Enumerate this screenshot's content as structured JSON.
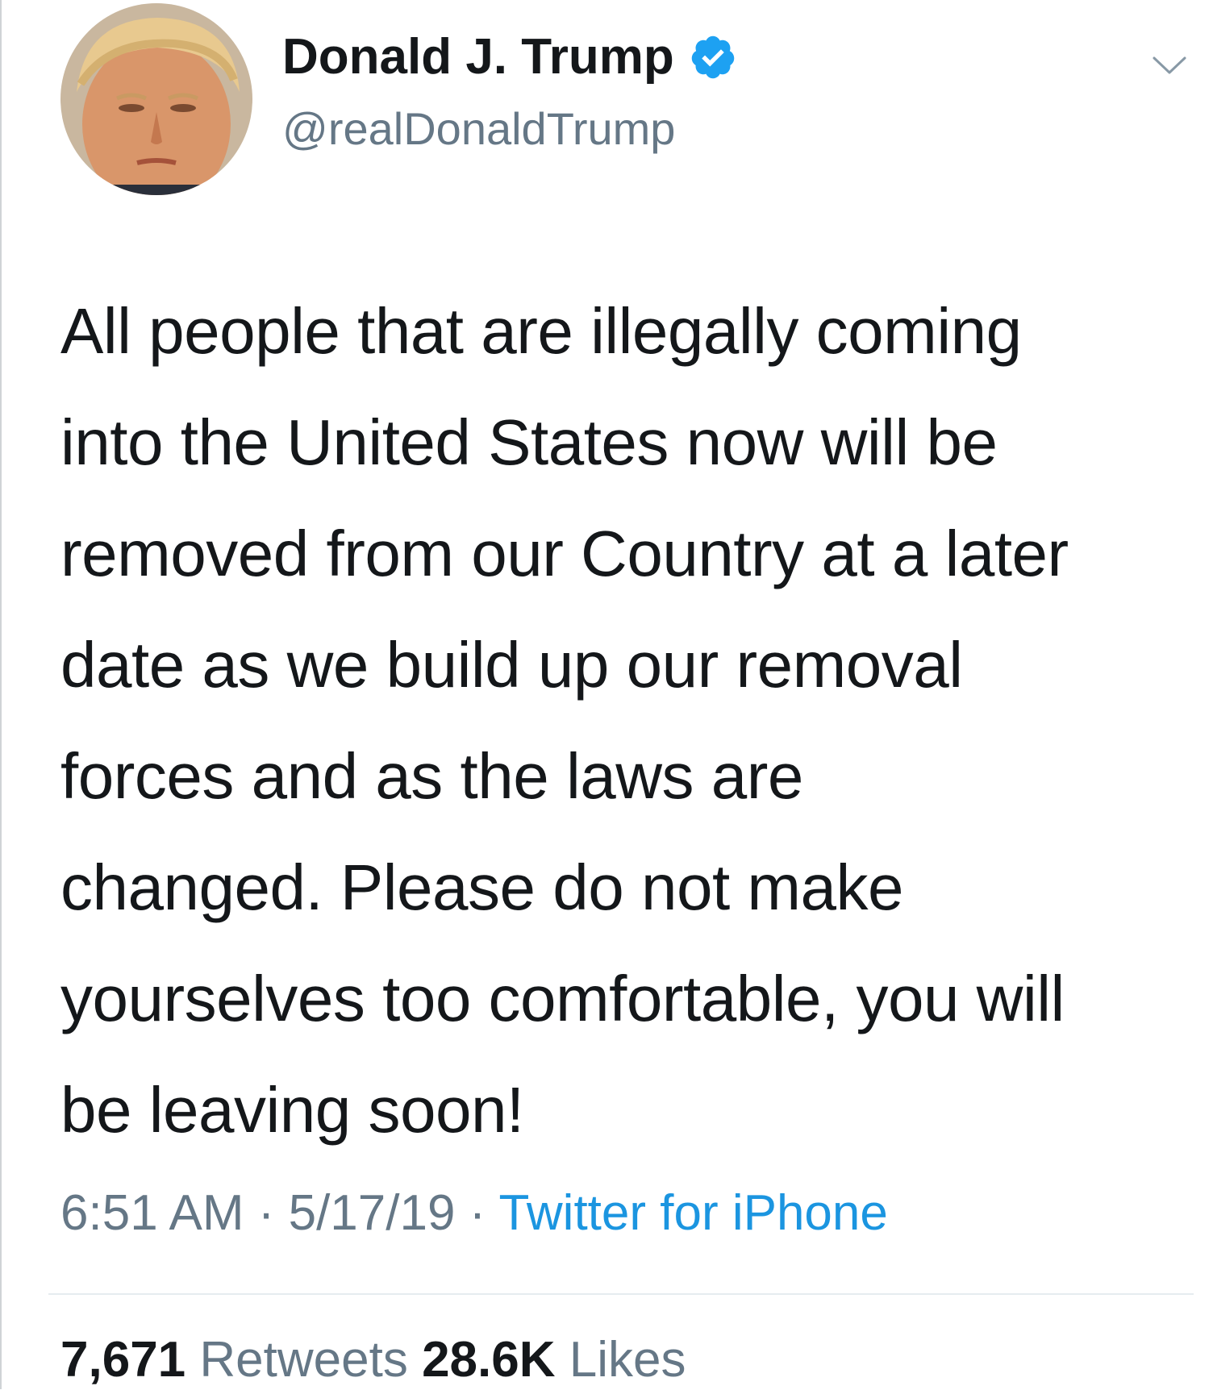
{
  "tweet": {
    "author": {
      "display_name": "Donald J. Trump",
      "handle": "@realDonaldTrump",
      "verified_icon": "verified-badge-icon",
      "avatar_icon": "avatar-photo"
    },
    "menu_icon": "chevron-down-icon",
    "text_lines": [
      "All people that are illegally coming",
      "into the United States now will be",
      "removed from our Country at a later",
      "date as we build up our removal",
      "forces and as the laws are",
      "changed. Please do not make",
      "yourselves too comfortable, you will",
      "be leaving soon!"
    ],
    "meta": {
      "time": "6:51 AM",
      "separator": " · ",
      "date": "5/17/19",
      "source": "Twitter for iPhone"
    },
    "stats": {
      "retweets_count": "7,671",
      "retweets_label": "Retweets",
      "likes_count": "28.6K",
      "likes_label": "Likes"
    }
  },
  "colors": {
    "text_primary": "#14171a",
    "text_secondary": "#657786",
    "link_blue": "#1b95e0",
    "verified_blue": "#1da1f2",
    "divider": "#e6ecf0"
  }
}
